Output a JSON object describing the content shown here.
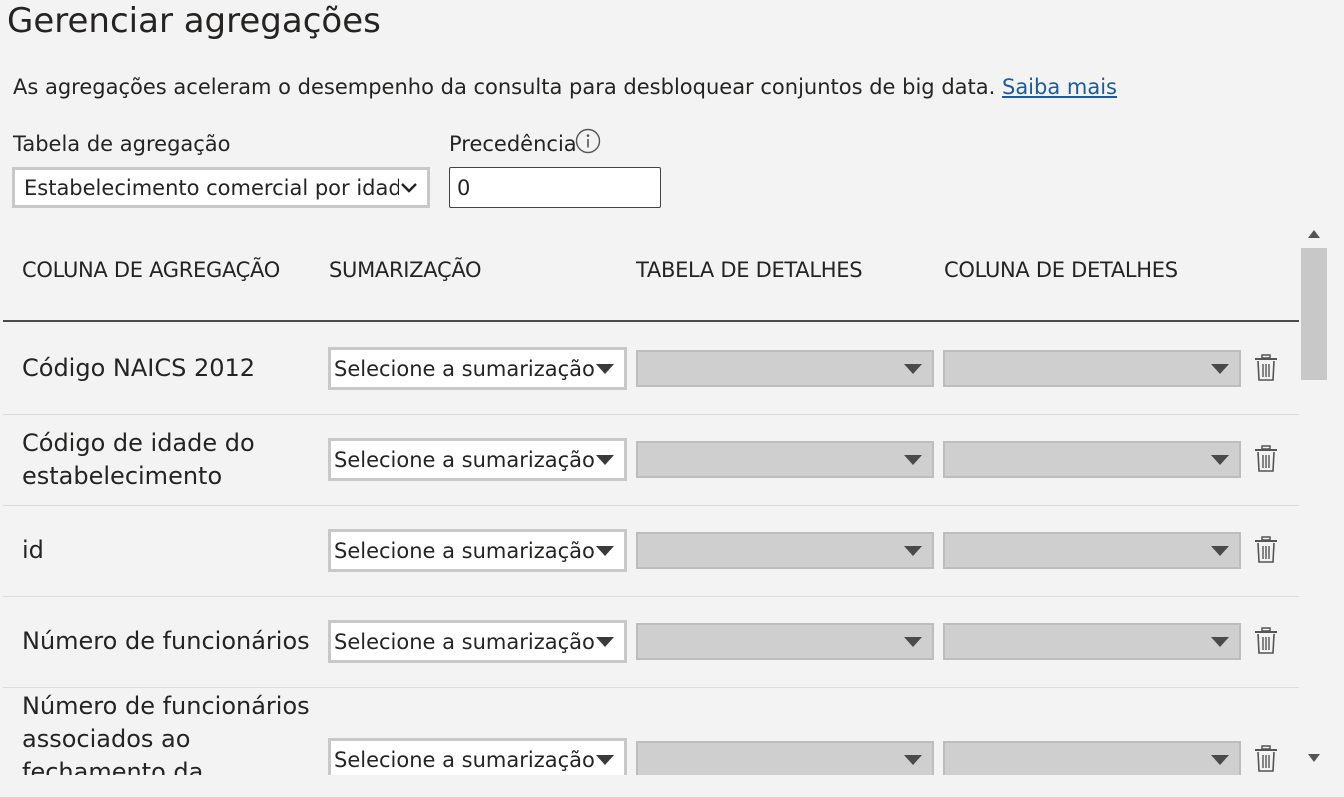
{
  "page": {
    "title": "Gerenciar agregações",
    "description": "As agregações aceleram o desempenho da consulta para desbloquear conjuntos de big data.",
    "learn_more": "Saiba mais"
  },
  "form": {
    "aggregation_table_label": "Tabela de agregação",
    "aggregation_table_value": "Estabelecimento comercial por idade",
    "precedence_label": "Precedência",
    "precedence_value": "0"
  },
  "grid": {
    "headers": {
      "aggregation_column": "COLUNA DE AGREGAÇÃO",
      "summarization": "SUMARIZAÇÃO",
      "detail_table": "TABELA DE DETALHES",
      "detail_column": "COLUNA DE DETALHES"
    },
    "summarization_placeholder": "Selecione a sumarização...",
    "rows": [
      {
        "name": "Código NAICS 2012",
        "summarization": "Selecione a sumarização..."
      },
      {
        "name": "Código de idade do estabelecimento",
        "summarization": "Selecione a sumarização..."
      },
      {
        "name": "id",
        "summarization": "Selecione a sumarização..."
      },
      {
        "name": "Número de funcionários",
        "summarization": "Selecione a sumarização..."
      },
      {
        "name": "Número de funcionários associados ao fechamento da empresa",
        "summarization": "Selecione a sumarização..."
      }
    ]
  },
  "colors": {
    "link": "#1d5a9e",
    "disabled_dropdown": "#cfcfcf",
    "background": "#f3f3f3"
  }
}
